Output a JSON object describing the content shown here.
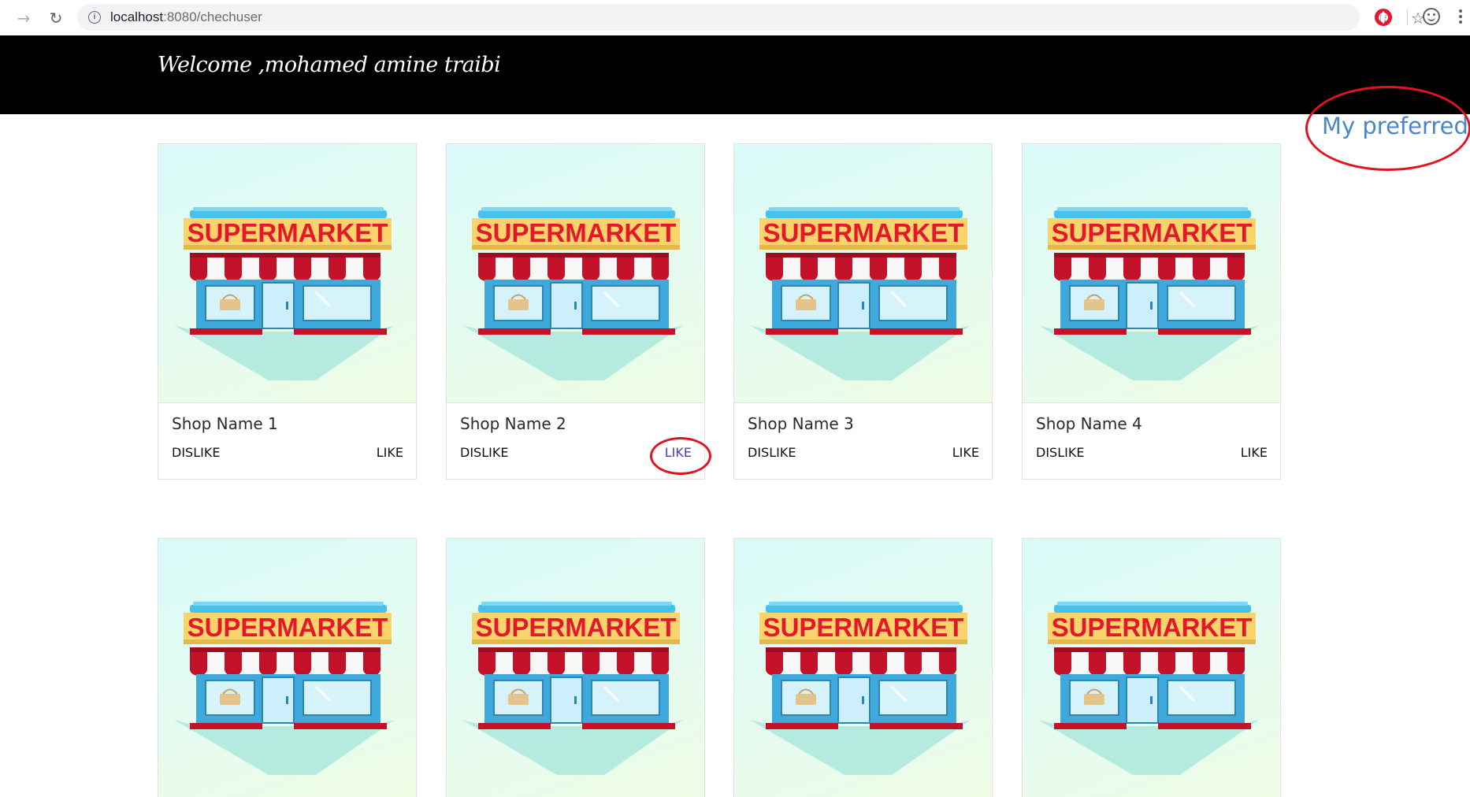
{
  "browser": {
    "url_host": "localhost",
    "url_path": ":8080/chechuser"
  },
  "header": {
    "welcome": "Welcome ,mohamed amine traibi"
  },
  "preferred_link": "My preferred",
  "shops": [
    {
      "name": "Shop Name 1",
      "dislike": "DISLIKE",
      "like": "LIKE",
      "sign": "SUPERMARKET"
    },
    {
      "name": "Shop Name 2",
      "dislike": "DISLIKE",
      "like": "LIKE",
      "sign": "SUPERMARKET"
    },
    {
      "name": "Shop Name 3",
      "dislike": "DISLIKE",
      "like": "LIKE",
      "sign": "SUPERMARKET"
    },
    {
      "name": "Shop Name 4",
      "dislike": "DISLIKE",
      "like": "LIKE",
      "sign": "SUPERMARKET"
    },
    {
      "sign": "SUPERMARKET"
    },
    {
      "sign": "SUPERMARKET"
    },
    {
      "sign": "SUPERMARKET"
    },
    {
      "sign": "SUPERMARKET"
    }
  ],
  "colors": {
    "header_bg": "#000000",
    "link_blue": "#4a86c8",
    "like_active": "#3f3fcf",
    "annotation_red": "#e0141e"
  }
}
